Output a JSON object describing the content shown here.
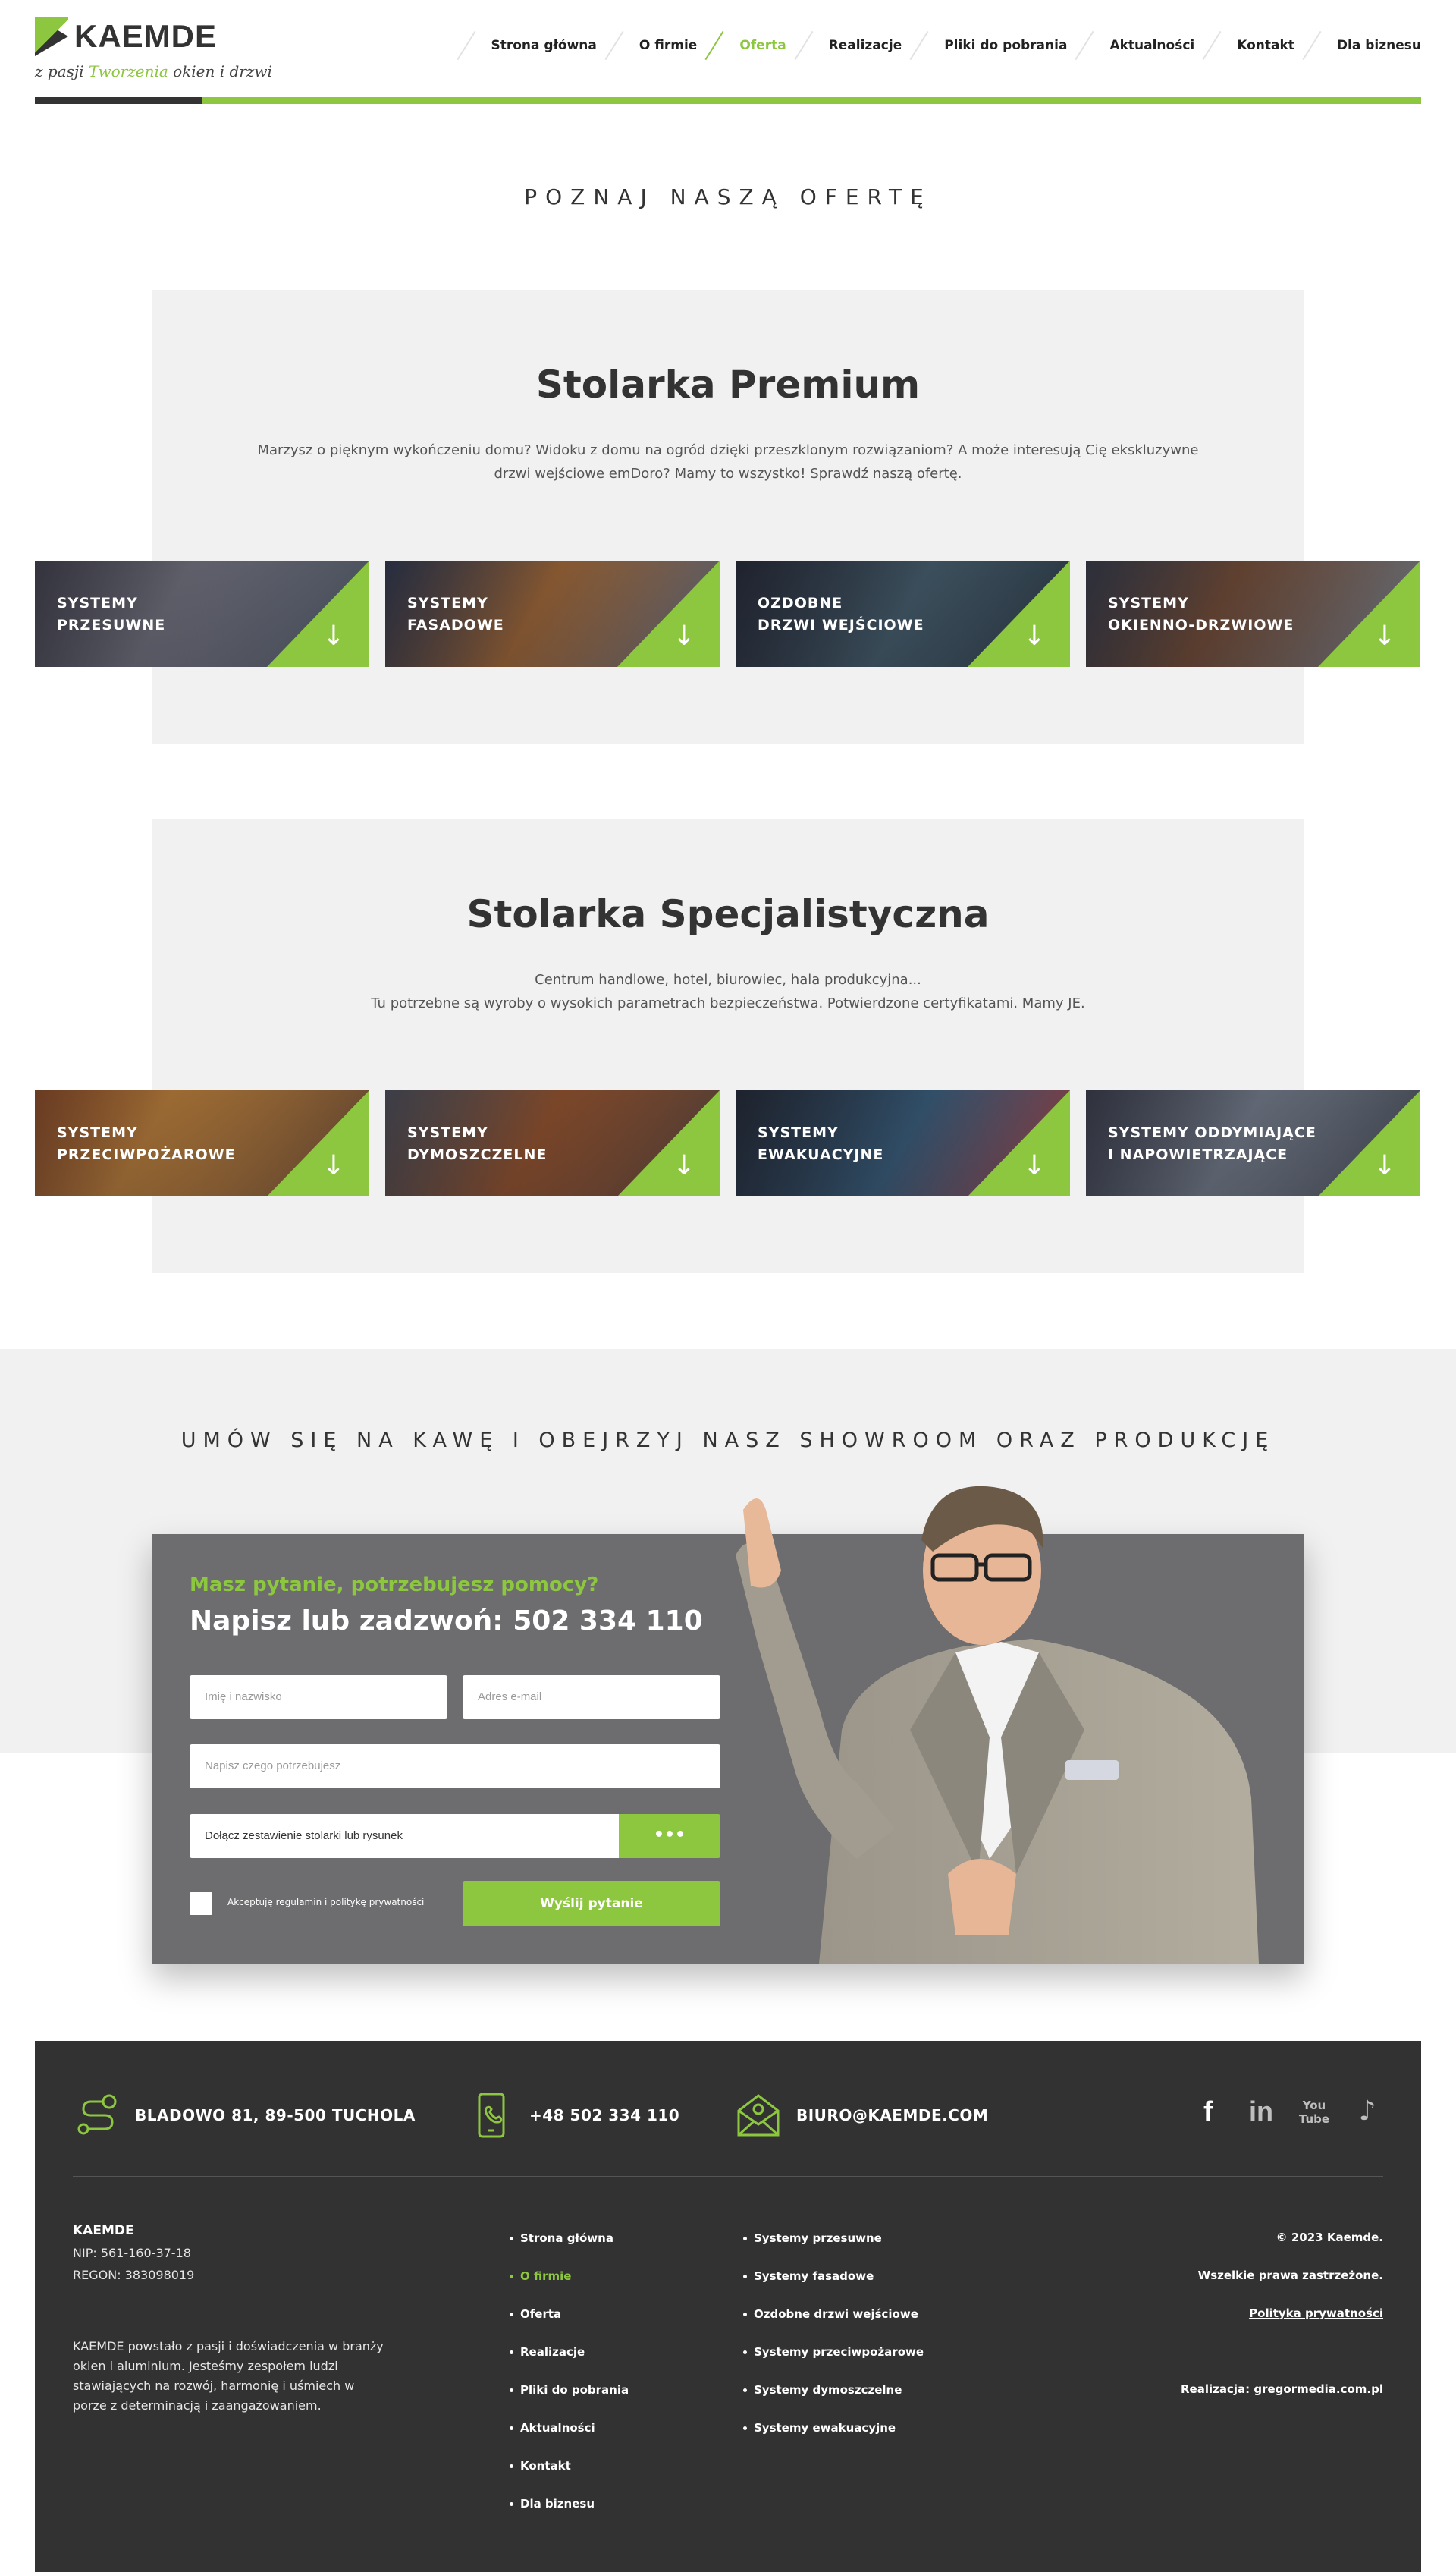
{
  "brand": {
    "name": "KAEMDE",
    "tagline_pre": "z pasji",
    "tagline_mid": "Tworzenia",
    "tagline_post": "okien i drzwi"
  },
  "nav": {
    "items": [
      "Strona główna",
      "O firmie",
      "Oferta",
      "Realizacje",
      "Pliki do pobrania",
      "Aktualności",
      "Kontakt",
      "Dla biznesu"
    ],
    "active_index": 2
  },
  "offer_title": "POZNAJ NASZĄ OFERTĘ",
  "premium": {
    "title": "Stolarka Premium",
    "text_line1": "Marzysz o pięknym wykończeniu domu? Widoku z domu na ogród dzięki przeszklonym rozwiązaniom? A może interesują Cię ekskluzywne",
    "text_line2": "drzwi wejściowe emDoro? Mamy to wszystko! Sprawdź naszą ofertę.",
    "tiles": [
      "SYSTEMY\nPRZESUWNE",
      "SYSTEMY\nFASADOWE",
      "OZDOBNE\nDRZWI WEJŚCIOWE",
      "SYSTEMY\nOKIENNO-DRZWIOWE"
    ]
  },
  "special": {
    "title": "Stolarka Specjalistyczna",
    "text_line1": "Centrum handlowe, hotel, biurowiec, hala produkcyjna...",
    "text_line2": "Tu potrzebne są wyroby o wysokich parametrach bezpieczeństwa. Potwierdzone certyfikatami. Mamy JE.",
    "tiles": [
      "SYSTEMY\nPRZECIWPOŻAROWE",
      "SYSTEMY\nDYMOSZCZELNE",
      "SYSTEMY\nEWAKUACYJNE",
      "SYSTEMY ODDYMIAJĄCE\nI NAPOWIETRZAJĄCE"
    ]
  },
  "cta": {
    "title": "UMÓW SIĘ NA KAWĘ I OBEJRZYJ NASZ SHOWROOM ORAZ PRODUKCJĘ",
    "question": "Masz pytanie, potrzebujesz pomocy?",
    "call": "Napisz lub zadzwoń: 502 334 110",
    "name_placeholder": "Imię i nazwisko",
    "email_placeholder": "Adres e-mail",
    "message_placeholder": "Napisz czego potrzebujesz",
    "attach_label": "Dołącz zestawienie stolarki lub rysunek",
    "attach_button": "•••",
    "consent": "Akceptuję regulamin i politykę prywatności",
    "submit": "Wyślij pytanie"
  },
  "footer": {
    "address": "BLADOWO 81, 89-500 TUCHOLA",
    "phone": "+48 502 334 110",
    "email": "BIURO@KAEMDE.COM",
    "company": "KAEMDE",
    "nip": "NIP: 561-160-37-18",
    "regon": "REGON: 383098019",
    "description": "KAEMDE powstało z pasji i doświadczenia w branży okien i aluminium. Jesteśmy zespołem ludzi stawiających na rozwój, harmonię i uśmiech w porze z determinacją i zaangażowaniem.",
    "menu": [
      "Strona główna",
      "O firmie",
      "Oferta",
      "Realizacje",
      "Pliki do pobrania",
      "Aktualności",
      "Kontakt",
      "Dla biznesu"
    ],
    "menu_active_index": 1,
    "systems": [
      "Systemy przesuwne",
      "Systemy fasadowe",
      "Ozdobne drzwi wejściowe",
      "Systemy przeciwpożarowe",
      "Systemy dymoszczelne",
      "Systemy ewakuacyjne"
    ],
    "copyright": "© 2023 Kaemde.",
    "rights": "Wszelkie prawa zastrzeżone.",
    "privacy": "Polityka prywatności",
    "credit": "Realizacja: gregormedia.com.pl"
  },
  "colors": {
    "accent": "#8dc63f",
    "dark": "#333233",
    "panel": "#f1f1f1",
    "form": "#6d6c6f"
  }
}
